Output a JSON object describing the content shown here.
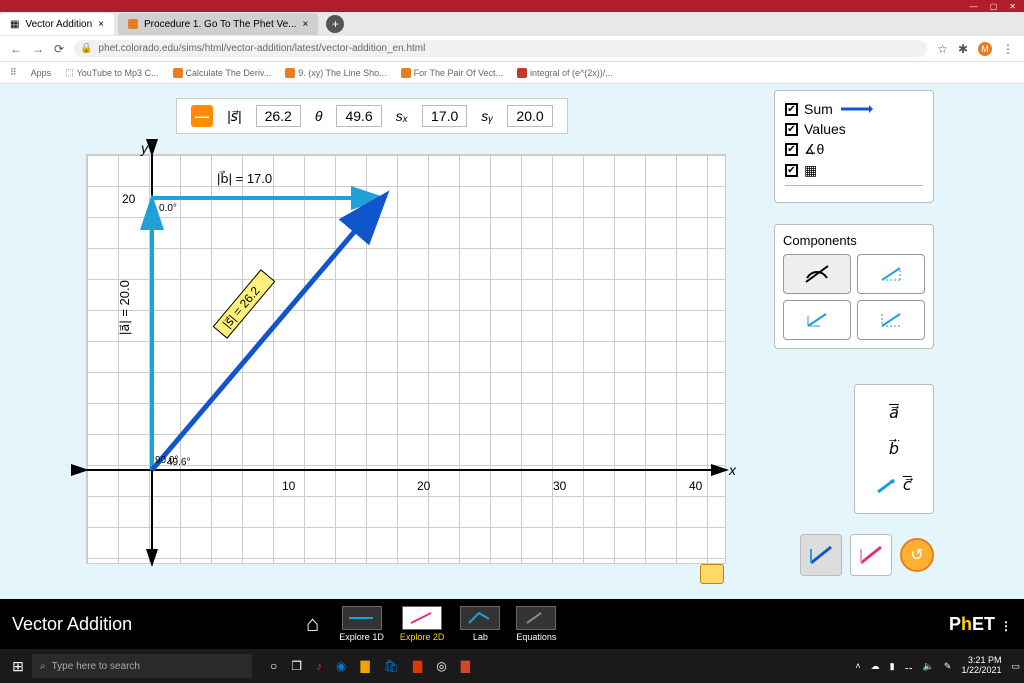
{
  "browser": {
    "tabs": [
      {
        "label": "Vector Addition",
        "active": true
      },
      {
        "label": "Procedure 1. Go To The Phet Ve...",
        "active": false
      }
    ],
    "url": "phet.colorado.edu/sims/html/vector-addition/latest/vector-addition_en.html",
    "bookmarks": [
      "Apps",
      "YouTube to Mp3 C...",
      "Calculate The Deriv...",
      "9. (xy) The Line Sho...",
      "For The Pair Of Vect...",
      "integral of (e^(2x))/..."
    ]
  },
  "readout": {
    "mag_label": "|s⃗|",
    "mag": "26.2",
    "theta_label": "θ",
    "theta": "49.6",
    "sx_label": "sₓ",
    "sx": "17.0",
    "sy_label": "sᵧ",
    "sy": "20.0"
  },
  "checks": {
    "sum": "Sum",
    "values": "Values"
  },
  "components_title": "Components",
  "graph": {
    "y_label": "y",
    "x_label": "x",
    "vec_a_label": "|a⃗| = 20.0",
    "vec_a_angle": "90.0°",
    "vec_b_label": "|b⃗| = 17.0",
    "vec_b_angle": "0.0°",
    "vec_s_label": "|s⃗| = 26.2",
    "vec_s_angle": "49.6°",
    "xticks": [
      "10",
      "20",
      "30",
      "40"
    ],
    "ytick": "20"
  },
  "vec_slots": {
    "a": "a⃗",
    "b": "b⃗",
    "c": "c⃗"
  },
  "sim": {
    "title": "Vector Addition",
    "screens": [
      "Explore 1D",
      "Explore 2D",
      "Lab",
      "Equations"
    ],
    "logo": "PhET"
  },
  "taskbar": {
    "search": "Type here to search",
    "time": "3:21 PM",
    "date": "1/22/2021"
  },
  "chart_data": {
    "type": "vector",
    "title": "Vector Addition — Explore 2D",
    "xlabel": "x",
    "ylabel": "y",
    "xlim": [
      -2,
      45
    ],
    "ylim": [
      -2,
      24
    ],
    "vectors": [
      {
        "name": "a",
        "tail": [
          0,
          0
        ],
        "tip": [
          0,
          20
        ],
        "magnitude": 20.0,
        "angle_deg": 90.0,
        "color": "#1ea0d8"
      },
      {
        "name": "b",
        "tail": [
          0,
          20
        ],
        "tip": [
          17,
          20
        ],
        "magnitude": 17.0,
        "angle_deg": 0.0,
        "color": "#1ea0d8"
      },
      {
        "name": "s (sum)",
        "tail": [
          0,
          0
        ],
        "tip": [
          17,
          20
        ],
        "magnitude": 26.2,
        "angle_deg": 49.6,
        "color": "#1155cc"
      }
    ],
    "grid": true
  }
}
